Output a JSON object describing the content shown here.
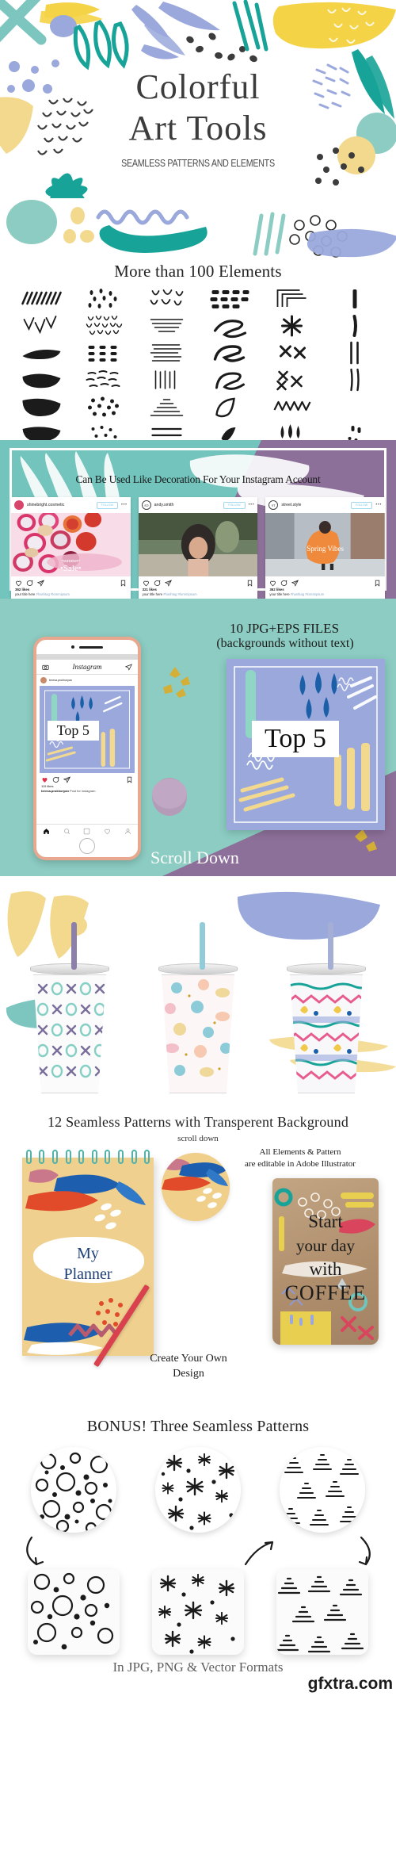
{
  "hero": {
    "title_line1": "Colorful",
    "title_line2": "Art Tools",
    "subtitle": "SEAMLESS PATTERNS AND ELEMENTS"
  },
  "elements_section": {
    "title": "More than 100 Elements"
  },
  "instagram_section": {
    "heading": "Can Be Used Like Decoration For Your Instagram Account",
    "follow_label": "FOLLOW",
    "menu_glyph": "•••",
    "posts": [
      {
        "avatar_initials": "",
        "username": "shinebright.cosmetic",
        "overlay_line1": "•summer•",
        "overlay_line2": "•Sale•",
        "likes": "362 likes",
        "caption": "your title here",
        "tags": "#hashtag #loremipsum"
      },
      {
        "avatar_initials": "AD",
        "username": "andy.smith",
        "overlay_line1": "",
        "overlay_line2": "",
        "likes": "321 likes",
        "caption": "your title here",
        "tags": "#hashtag #loremipsum"
      },
      {
        "avatar_initials": "ST",
        "username": "street.style",
        "overlay_line1": "Spring Vibes",
        "overlay_line2": "",
        "likes": "362 likes",
        "caption": "your title here",
        "tags": "#hashtag #loremipsum"
      }
    ]
  },
  "phone_section": {
    "files_title": "10 JPG+EPS FILES",
    "files_subtitle": "(backgrounds without text)",
    "scroll_label": "Scroll Down",
    "phone": {
      "app_name": "Instagram",
      "username": "teresa.prokhoryan",
      "post_label": "Top 5",
      "likes": "115 likes",
      "caption_user": "teresa.prokhoryan",
      "caption_text": "Post for instagram"
    },
    "big_card_label": "Top 5"
  },
  "tumblers_section": {
    "title": "12 Seamless Patterns with Transperent Background",
    "subtitle": "scroll down"
  },
  "planner_section": {
    "illustrator_note_line1": "All Elements & Pattern",
    "illustrator_note_line2": "are editable in Adobe Illustrator",
    "notebook_line1": "My",
    "notebook_line2": "Planner",
    "pouch_line1": "Start",
    "pouch_line2": "your day",
    "pouch_line3": "with",
    "pouch_line4": "COFFEE",
    "create_line1": "Create Your Own",
    "create_line2": "Design"
  },
  "bonus_section": {
    "title": "BONUS! Three Seamless Patterns",
    "footer": "In JPG, PNG & Vector Formats",
    "watermark": "gfxtra.com"
  },
  "colors": {
    "teal": "#17a398",
    "light_teal": "#8cccc2",
    "yellow": "#f5d346",
    "light_yellow": "#f3d98e",
    "periwinkle": "#9aa8dc",
    "purple_band": "#8d7099",
    "dark_text": "#3c3c3c",
    "ink": "#1b1b1b",
    "red": "#e14b2a",
    "blue": "#1d5fae"
  }
}
